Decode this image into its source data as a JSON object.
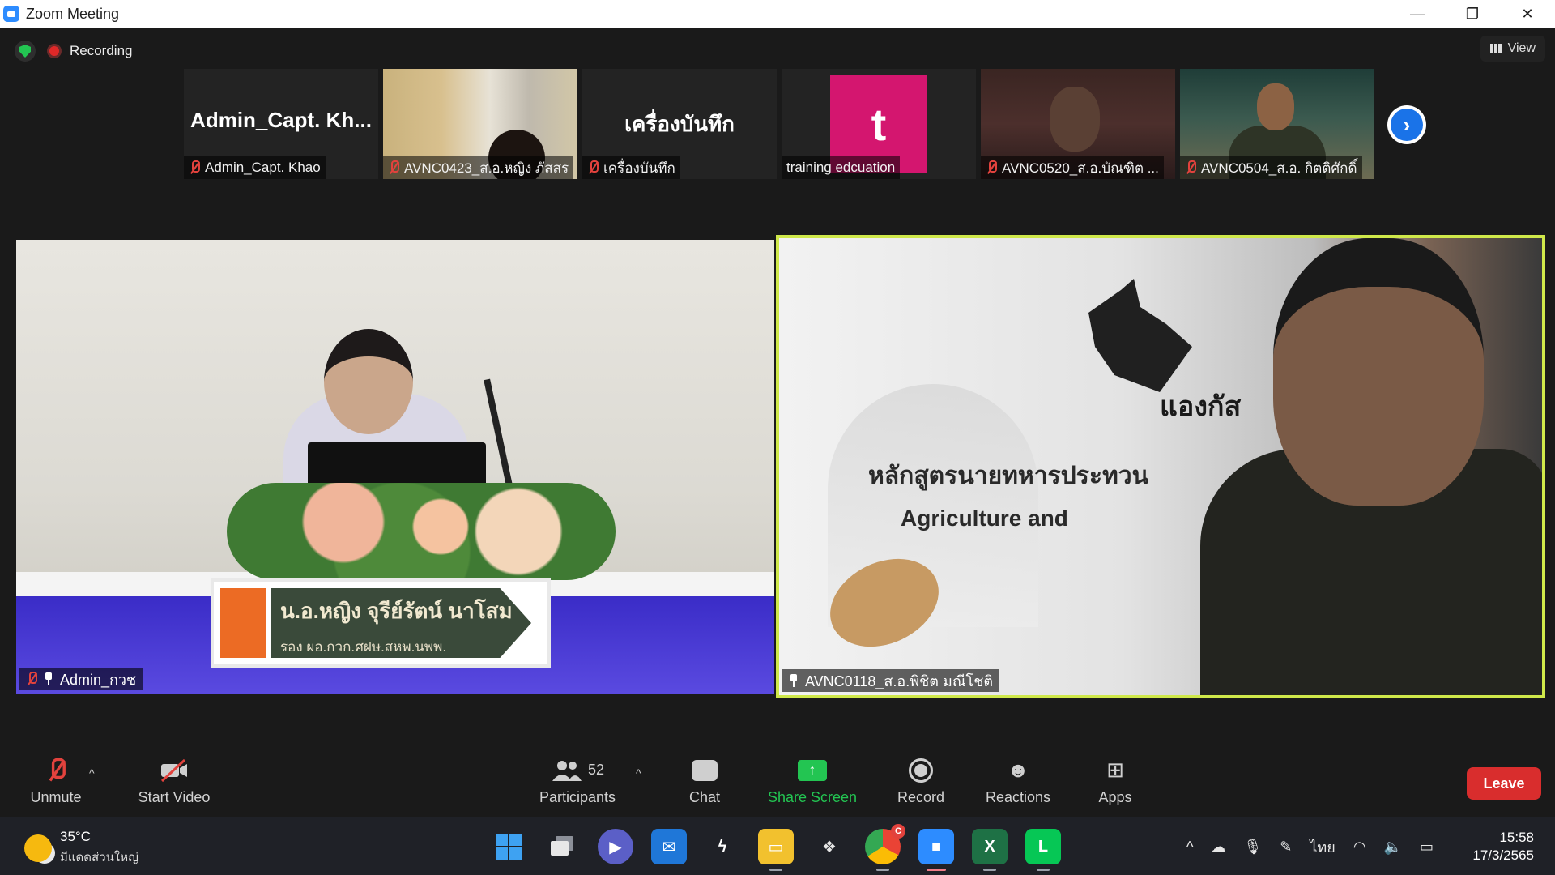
{
  "window": {
    "title": "Zoom Meeting",
    "controls": [
      "—",
      "❐",
      "✕"
    ]
  },
  "header": {
    "recording_label": "Recording",
    "view_label": "View"
  },
  "thumbnails": [
    {
      "big_name": "Admin_Capt. Kh...",
      "label": "Admin_Capt. Khao",
      "muted": true
    },
    {
      "big_name": "",
      "label": "AVNC0423_ส.อ.หญิง ภัสสร",
      "muted": true
    },
    {
      "big_name": "เครื่องบันทึก",
      "label": "เครื่องบันทึก",
      "muted": true
    },
    {
      "big_name": "",
      "label": "training edcuation",
      "muted": false,
      "avatar_letter": "t",
      "avatar_color": "#d4166f"
    },
    {
      "big_name": "",
      "label": "AVNC0520_ส.อ.บัณฑิต ...",
      "muted": true
    },
    {
      "big_name": "",
      "label": "AVNC0504_ส.อ. กิตติศักดิ์",
      "muted": true
    }
  ],
  "main_videos": {
    "left": {
      "label": "Admin_กวช",
      "nameplate_line1": "น.อ.หญิง จุรีย์รัตน์  นาโสม",
      "nameplate_line2": "รอง ผอ.กวก.ศฝษ.สหพ.นพพ."
    },
    "right": {
      "label": "AVNC0118_ส.อ.พิชิต มณีโชติ",
      "slide_brand": "แองกัส",
      "slide_line1": "หลักสูตรนายทหารประทวน",
      "slide_line2": "Agriculture and",
      "active_speaker_color": "#cfe84a"
    }
  },
  "toolbar": {
    "unmute": "Unmute",
    "start_video": "Start Video",
    "participants": "Participants",
    "participants_count": "52",
    "chat": "Chat",
    "share_screen": "Share Screen",
    "record": "Record",
    "reactions": "Reactions",
    "apps": "Apps",
    "leave": "Leave"
  },
  "taskbar": {
    "weather_temp": "35°C",
    "weather_cond": "มีแดดส่วนใหญ่",
    "lang": "ไทย",
    "time": "15:58",
    "date": "17/3/2565",
    "chrome_badge": "C"
  }
}
